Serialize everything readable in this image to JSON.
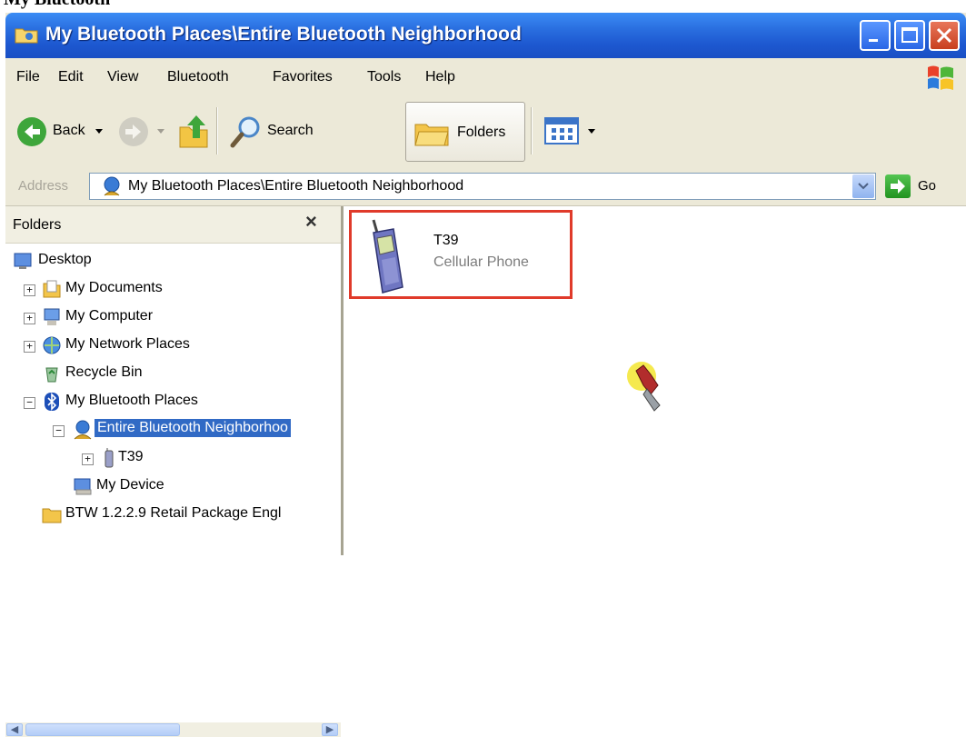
{
  "window": {
    "title": "My Bluetooth Places\\Entire Bluetooth Neighborhood"
  },
  "menu": [
    "File",
    "Edit",
    "View",
    "Bluetooth",
    "Favorites",
    "Tools",
    "Help"
  ],
  "toolbar": {
    "back_label": "Back",
    "search_label": "Search",
    "folders_label": "Folders"
  },
  "address": {
    "label": "Address",
    "value": "My Bluetooth Places\\Entire Bluetooth Neighborhood",
    "go_label": "Go"
  },
  "folders_pane": {
    "title": "Folders",
    "close": "×",
    "tree": [
      {
        "label": "Desktop",
        "icon": "desktop-icon"
      },
      {
        "label": "My Documents",
        "icon": "documents-icon",
        "expander": "+"
      },
      {
        "label": "My Computer",
        "icon": "computer-icon",
        "expander": "+"
      },
      {
        "label": "My Network Places",
        "icon": "network-icon",
        "expander": "+"
      },
      {
        "label": "Recycle Bin",
        "icon": "recycle-bin-icon"
      },
      {
        "label": "My Bluetooth Places",
        "icon": "bluetooth-icon",
        "expander": "−"
      },
      {
        "label": "Entire Bluetooth Neighborhoo",
        "icon": "neighborhood-icon",
        "expander": "−",
        "selected": true
      },
      {
        "label": "T39",
        "icon": "phone-icon",
        "expander": "+"
      },
      {
        "label": "My Device",
        "icon": "my-device-icon"
      },
      {
        "label": "BTW 1.2.2.9 Retail Package Engl",
        "icon": "folder-icon"
      }
    ]
  },
  "content": {
    "devices": [
      {
        "name": "T39",
        "type": "Cellular Phone",
        "icon": "cellular-phone-icon"
      }
    ]
  },
  "colors": {
    "titlebar": "#2a6fe0",
    "highlight_box": "#e03a2a",
    "selection": "#316ac5"
  }
}
